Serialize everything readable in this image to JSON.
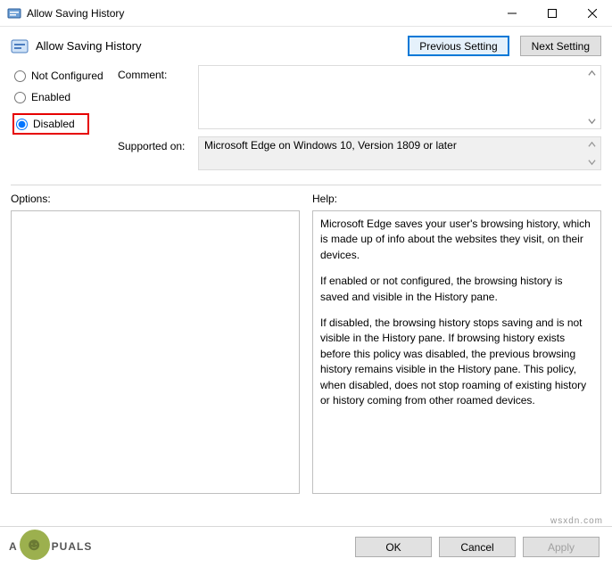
{
  "window": {
    "title": "Allow Saving History"
  },
  "header": {
    "policy_title": "Allow Saving History",
    "previous_button": "Previous Setting",
    "next_button": "Next Setting"
  },
  "radios": {
    "not_configured": "Not Configured",
    "enabled": "Enabled",
    "disabled": "Disabled",
    "selected": "disabled"
  },
  "fields": {
    "comment_label": "Comment:",
    "comment_value": "",
    "supported_label": "Supported on:",
    "supported_value": "Microsoft Edge on Windows 10, Version 1809 or later"
  },
  "sections": {
    "options_label": "Options:",
    "help_label": "Help:"
  },
  "help": {
    "p1": "Microsoft Edge saves your user's browsing history, which is made up of info about the websites they visit, on their devices.",
    "p2": "If enabled or not configured, the browsing history is saved and visible in the History pane.",
    "p3": "If disabled, the browsing history stops saving and is not visible in the History pane. If browsing history exists before this policy was disabled, the previous browsing history remains visible in the History pane. This policy, when disabled, does not stop roaming of existing history or history coming from other roamed devices."
  },
  "footer": {
    "ok": "OK",
    "cancel": "Cancel",
    "apply": "Apply"
  },
  "watermark": "wsxdn.com",
  "brand": {
    "pre": "A",
    "post": "PUALS"
  }
}
